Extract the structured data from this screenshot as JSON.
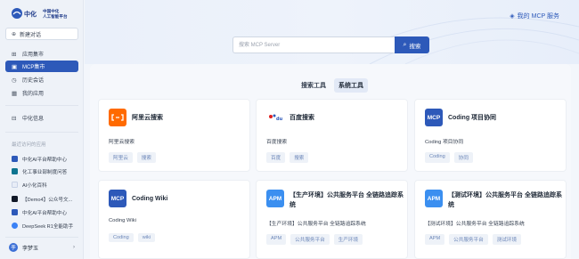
{
  "brand": {
    "logo_text": "中化",
    "logo_sub_line1": "中国中化",
    "logo_sub_line2": "人工智能平台"
  },
  "sidebar": {
    "new_chat_label": "新建对话",
    "nav": [
      {
        "label": "应用集市",
        "icon": "apps-icon"
      },
      {
        "label": "MCP集市",
        "icon": "mcp-icon",
        "active": true
      },
      {
        "label": "历史会话",
        "icon": "history-icon"
      },
      {
        "label": "我的应用",
        "icon": "my-apps-icon"
      },
      {
        "label": "中化信息",
        "icon": "info-icon"
      }
    ],
    "recent_label": "最近访问的应用",
    "recent": [
      {
        "label": "中化AI平台帮助中心",
        "color": "#2d59b9"
      },
      {
        "label": "化工事业部制度问答",
        "color": "#0e7490"
      },
      {
        "label": "AI小化百科",
        "color": "#e8edf7"
      },
      {
        "label": "【Demo4】公众号文...",
        "color": "#111827"
      },
      {
        "label": "中化AI平台帮助中心",
        "color": "#2d59b9"
      },
      {
        "label": "DeepSeek R1全能助手",
        "color": "#3b82f6"
      }
    ],
    "user": {
      "avatar": "李",
      "name": "李梦玉"
    }
  },
  "header": {
    "my_mcp_label": "我的 MCP 服务",
    "search_placeholder": "搜索 MCP Server",
    "search_button": "搜索"
  },
  "tabs": [
    {
      "label": "搜索工具",
      "active": false
    },
    {
      "label": "系统工具",
      "active": true
    }
  ],
  "cards": [
    {
      "icon_text": "",
      "icon_color": "#ff6a00",
      "icon_name": "aliyun-icon",
      "title": "阿里云搜索",
      "desc": "阿里云搜索",
      "tags": [
        "阿里云",
        "搜索"
      ]
    },
    {
      "icon_text": "",
      "icon_color": "#ffffff",
      "icon_name": "baidu-icon",
      "title": "百度搜索",
      "desc": "百度搜索",
      "tags": [
        "百度",
        "搜索"
      ]
    },
    {
      "icon_text": "MCP",
      "icon_color": "#2d59b9",
      "icon_name": "mcp-badge-icon",
      "title": "Coding 项目协同",
      "desc": "Coding 项目协同",
      "tags": [
        "Coding",
        "协同"
      ]
    },
    {
      "icon_text": "MCP",
      "icon_color": "#2d59b9",
      "icon_name": "mcp-badge-icon",
      "title": "Coding Wiki",
      "desc": "Coding Wiki",
      "tags": [
        "Coding",
        "wiki"
      ]
    },
    {
      "icon_text": "APM",
      "icon_color": "#3b8ff0",
      "icon_name": "apm-icon",
      "title": "【生产环境】公共服务平台 全链路追踪系统",
      "desc": "【生产环境】公共服务平台 全链路追踪系统",
      "tags": [
        "APM",
        "公共服务平台",
        "生产环境"
      ]
    },
    {
      "icon_text": "APM",
      "icon_color": "#3b8ff0",
      "icon_name": "apm-icon",
      "title": "【测试环境】公共服务平台 全链路追踪系统",
      "desc": "【测试环境】公共服务平台 全链路追踪系统",
      "tags": [
        "APM",
        "公共服务平台",
        "测试环境"
      ]
    }
  ]
}
